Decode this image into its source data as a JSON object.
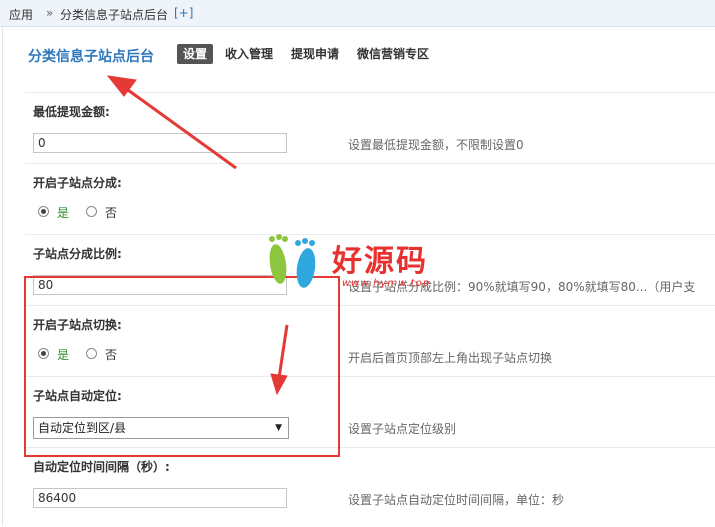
{
  "breadcrumb": {
    "root": "应用",
    "sep": "»",
    "current": "分类信息子站点后台",
    "add": "[+]"
  },
  "header": {
    "title": "分类信息子站点后台",
    "tabs": [
      {
        "label": "设置",
        "active": true
      },
      {
        "label": "收入管理",
        "active": false
      },
      {
        "label": "提现申请",
        "active": false
      },
      {
        "label": "微信营销专区",
        "active": false
      }
    ]
  },
  "form": {
    "min_withdraw": {
      "label": "最低提现金额:",
      "value": "0",
      "hint": "设置最低提现金额，不限制设置0"
    },
    "enable_split": {
      "label": "开启子站点分成:",
      "yes": "是",
      "no": "否",
      "selected": "yes"
    },
    "split_ratio": {
      "label": "子站点分成比例:",
      "value": "80",
      "hint": "设置子站点分成比例：90%就填写90，80%就填写80...（用户支"
    },
    "enable_switch": {
      "label": "开启子站点切换:",
      "yes": "是",
      "no": "否",
      "selected": "yes",
      "hint": "开启后首页顶部左上角出现子站点切换"
    },
    "auto_locate": {
      "label": "子站点自动定位:",
      "selected_option": "自动定位到区/县",
      "hint": "设置子站点定位级别"
    },
    "locate_interval": {
      "label": "自动定位时间间隔（秒）:",
      "value": "86400",
      "hint": "设置子站点自动定位时间间隔，单位：秒"
    }
  },
  "watermark": {
    "text": "好源码",
    "url": "www.hymw.top"
  },
  "colors": {
    "accent": "#2e77bd",
    "annotation_red": "#e53935",
    "yes_green": "#2f8f2f"
  }
}
